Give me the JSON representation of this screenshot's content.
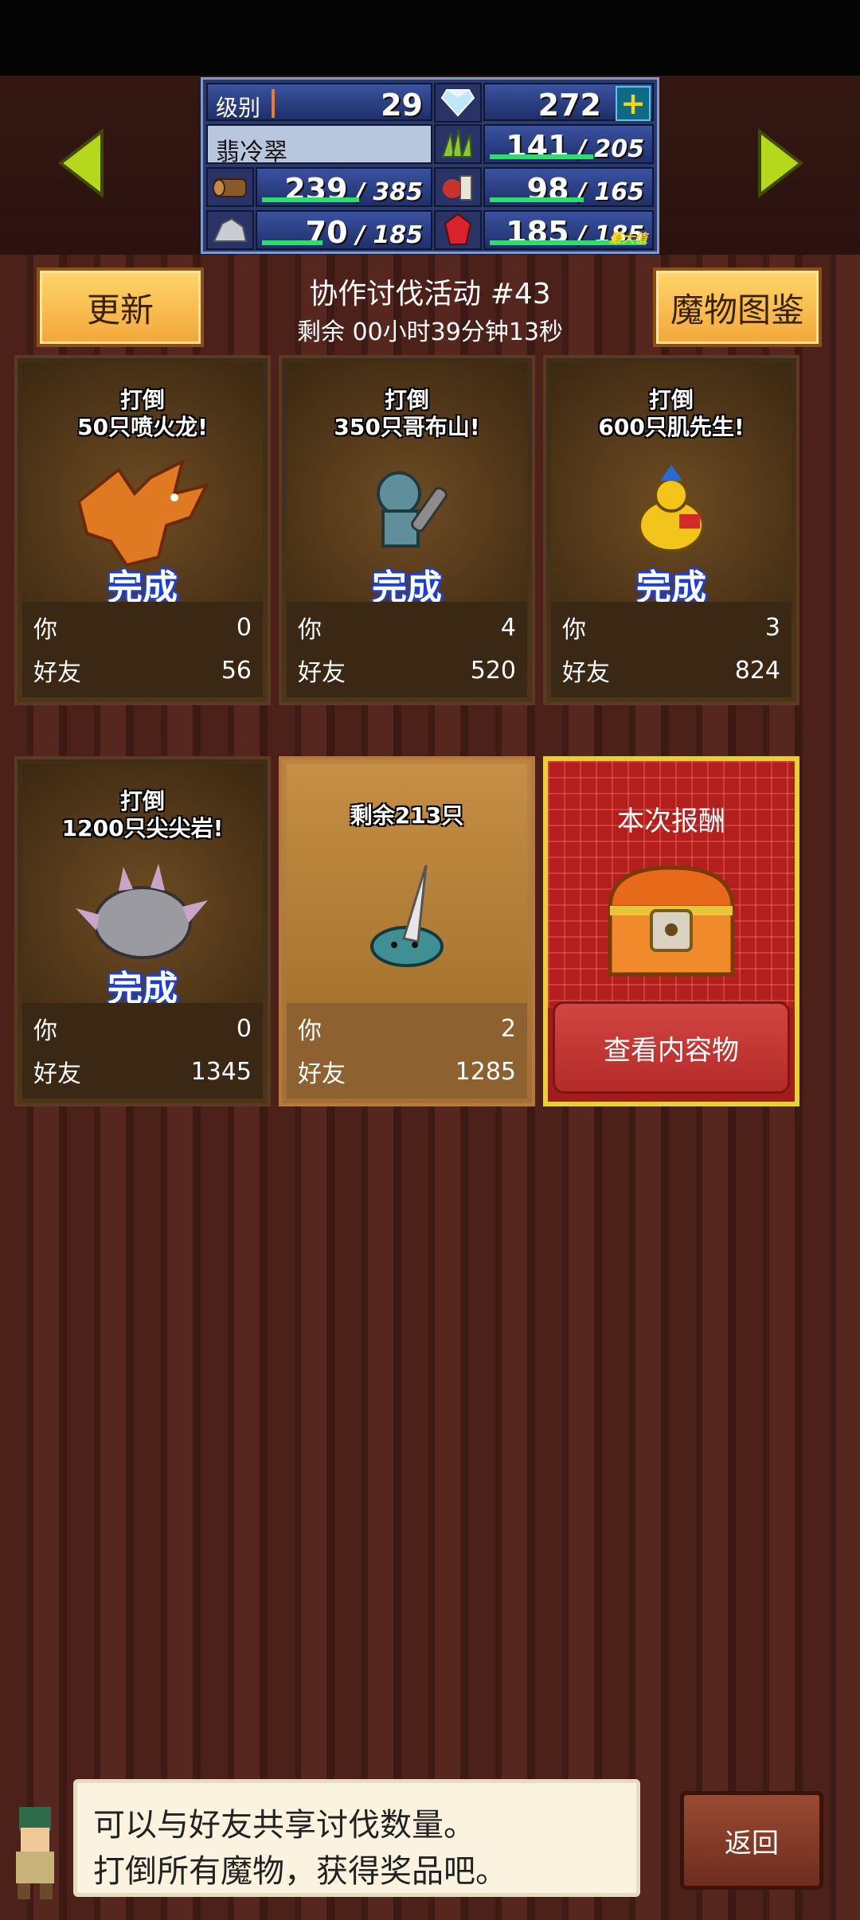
{
  "status": {
    "level_label": "级别",
    "level": "29",
    "gems": "272",
    "player_name": "翡冷翠",
    "grass": {
      "cur": "141",
      "max": "205",
      "fill": 0.69
    },
    "wood": {
      "cur": "239",
      "max": "385",
      "fill": 0.62
    },
    "food": {
      "cur": "98",
      "max": "165",
      "fill": 0.59
    },
    "ore": {
      "cur": "70",
      "max": "185",
      "fill": 0.38
    },
    "crystal": {
      "cur": "185",
      "max": "185",
      "fill": 1.0,
      "tag": "最大值"
    }
  },
  "header": {
    "refresh_label": "更新",
    "event_title": "协作讨伐活动 #43",
    "timer": "剩余 00小时39分钟13秒",
    "bestiary_label": "魔物图鉴"
  },
  "cards": [
    {
      "title_l1": "打倒",
      "title_l2": "50只喷火龙!",
      "done": "完成",
      "you_label": "你",
      "you": "0",
      "friend_label": "好友",
      "friend": "56"
    },
    {
      "title_l1": "打倒",
      "title_l2": "350只哥布山!",
      "done": "完成",
      "you_label": "你",
      "you": "4",
      "friend_label": "好友",
      "friend": "520"
    },
    {
      "title_l1": "打倒",
      "title_l2": "600只肌先生!",
      "done": "完成",
      "you_label": "你",
      "you": "3",
      "friend_label": "好友",
      "friend": "824"
    },
    {
      "title_l1": "打倒",
      "title_l2": "1200只尖尖岩!",
      "done": "完成",
      "you_label": "你",
      "you": "0",
      "friend_label": "好友",
      "friend": "1345"
    },
    {
      "title_l1": "剩余213只",
      "title_l2": "",
      "done": "",
      "you_label": "你",
      "you": "2",
      "friend_label": "好友",
      "friend": "1285"
    }
  ],
  "reward": {
    "title": "本次报酬",
    "button": "查看内容物"
  },
  "dialog": {
    "line1": "可以与好友共享讨伐数量。",
    "line2": "打倒所有魔物，获得奖品吧。"
  },
  "back_label": "返回",
  "colors": {
    "accent_gold": "#ffd66a",
    "bar_green": "#2ede6a",
    "done_blue": "#1d3fd6",
    "reward_red": "#a11c1a"
  }
}
